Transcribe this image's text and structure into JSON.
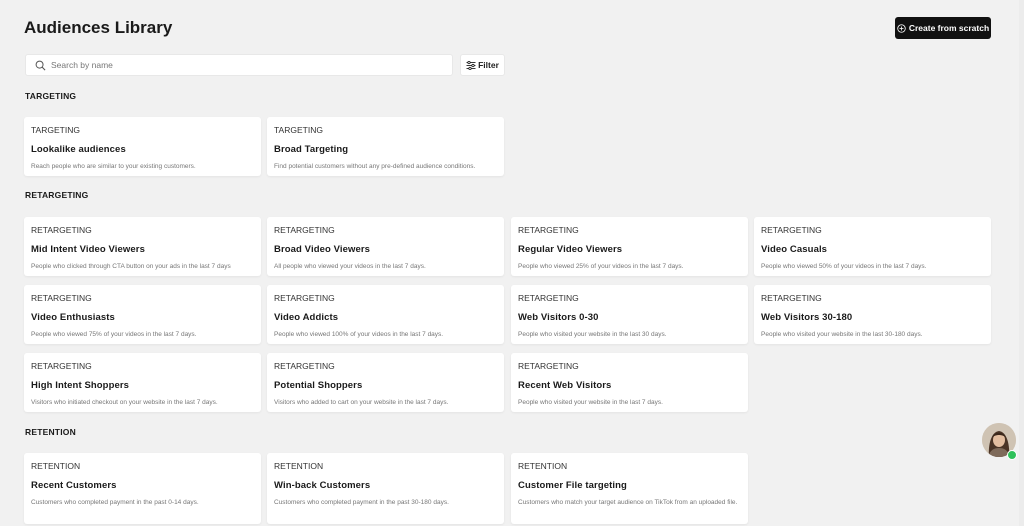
{
  "header": {
    "title": "Audiences Library",
    "create_label": "Create from scratch"
  },
  "search": {
    "placeholder": "Search by name",
    "value": ""
  },
  "filter": {
    "label": "Filter"
  },
  "sections": [
    {
      "heading": "TARGETING",
      "cards": [
        {
          "tag": "TARGETING",
          "title": "Lookalike audiences",
          "desc": "Reach people who are similar to your existing customers."
        },
        {
          "tag": "TARGETING",
          "title": "Broad Targeting",
          "desc": "Find potential customers without any pre-defined audience conditions."
        }
      ]
    },
    {
      "heading": "RETARGETING",
      "cards": [
        {
          "tag": "RETARGETING",
          "title": "Mid Intent Video Viewers",
          "desc": "People who clicked through CTA button on your ads in the last 7 days"
        },
        {
          "tag": "RETARGETING",
          "title": "Broad Video Viewers",
          "desc": "All people who viewed your videos in the last 7 days."
        },
        {
          "tag": "RETARGETING",
          "title": "Regular Video Viewers",
          "desc": "People who viewed 25% of your videos in the last 7 days."
        },
        {
          "tag": "RETARGETING",
          "title": "Video Casuals",
          "desc": "People who viewed 50% of your videos in the last 7 days."
        },
        {
          "tag": "RETARGETING",
          "title": "Video Enthusiasts",
          "desc": "People who viewed 75% of your videos in the last 7 days."
        },
        {
          "tag": "RETARGETING",
          "title": "Video Addicts",
          "desc": "People who viewed 100% of your videos in the last 7 days."
        },
        {
          "tag": "RETARGETING",
          "title": "Web Visitors 0-30",
          "desc": "People who visited your website in the last 30 days."
        },
        {
          "tag": "RETARGETING",
          "title": "Web Visitors 30-180",
          "desc": "People who visited your website in the last 30-180 days."
        },
        {
          "tag": "RETARGETING",
          "title": "High Intent Shoppers",
          "desc": "Visitors who initiated checkout on your website in the last 7 days."
        },
        {
          "tag": "RETARGETING",
          "title": "Potential Shoppers",
          "desc": "Visitors who added to cart on your website in the last 7 days."
        },
        {
          "tag": "RETARGETING",
          "title": "Recent Web Visitors",
          "desc": "People who visited your website in the last 7 days."
        }
      ]
    },
    {
      "heading": "RETENTION",
      "cards": [
        {
          "tag": "RETENTION",
          "title": "Recent Customers",
          "desc": "Customers who completed payment in the past 0-14 days."
        },
        {
          "tag": "RETENTION",
          "title": "Win-back Customers",
          "desc": "Customers who completed payment in the past 30-180 days."
        },
        {
          "tag": "RETENTION",
          "title": "Customer File targeting",
          "desc": "Customers who match your target audience on TikTok from an uploaded file."
        }
      ]
    }
  ],
  "colors": {
    "background": "#f1f1f1",
    "primary_button": "#111111",
    "online_status": "#2fc15a"
  }
}
